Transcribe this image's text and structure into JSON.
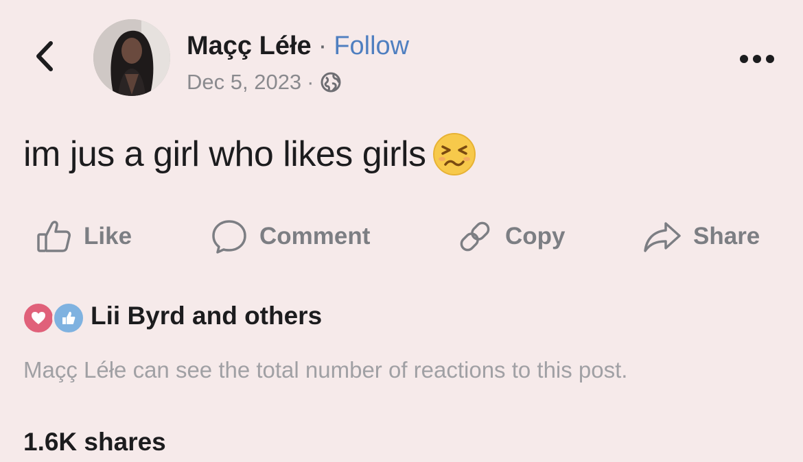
{
  "post": {
    "author": {
      "name": "Maçç Léłe",
      "separator": "·",
      "follow_label": "Follow"
    },
    "meta": {
      "date": "Dec 5, 2023",
      "separator": "·",
      "audience_icon": "globe-icon"
    },
    "text": "im jus a girl who likes girls",
    "emoji": "persevering-face-emoji"
  },
  "actions": {
    "like_label": "Like",
    "comment_label": "Comment",
    "copy_label": "Copy",
    "share_label": "Share"
  },
  "reactions": {
    "icons": [
      "heart-reaction-icon",
      "like-reaction-icon"
    ],
    "summary": "Lii Byrd and others",
    "privacy_note": "Maçç Léłe can see the total number of reactions to this post."
  },
  "shares": {
    "count_label": "1.6K shares"
  },
  "colors": {
    "background": "#f6eaea",
    "follow_link": "#4f7fc0",
    "heart_reaction": "#e0617a",
    "like_reaction": "#7fb2e0"
  }
}
